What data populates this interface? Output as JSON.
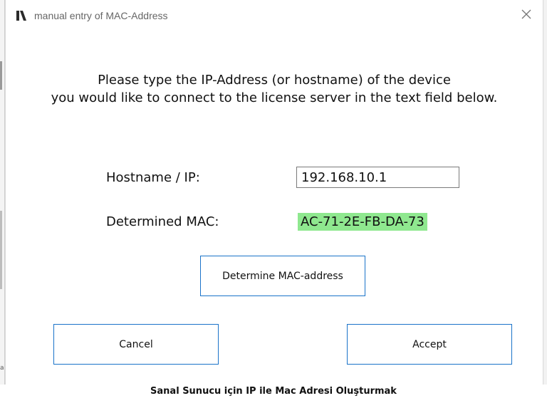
{
  "window": {
    "title": "manual entry of MAC-Address",
    "icon": "app-logo-icon",
    "close_icon": "close-icon"
  },
  "instructions": {
    "line1": "Please type the IP-Address (or hostname) of the device",
    "line2": "you would like to connect to the license server in the text field below."
  },
  "form": {
    "hostname_label": "Hostname / IP:",
    "hostname_value": "192.168.10.1",
    "mac_label": "Determined MAC:",
    "mac_value": "AC-71-2E-FB-DA-73",
    "mac_highlight_color": "#8fe88f"
  },
  "buttons": {
    "determine_label": "Determine MAC-address",
    "cancel_label": "Cancel",
    "accept_label": "Accept",
    "border_color": "#1a73c9"
  },
  "caption": "Sanal Sunucu için IP ile Mac Adresi Oluşturmak",
  "background_fragment": {
    "left_letter": "a"
  }
}
